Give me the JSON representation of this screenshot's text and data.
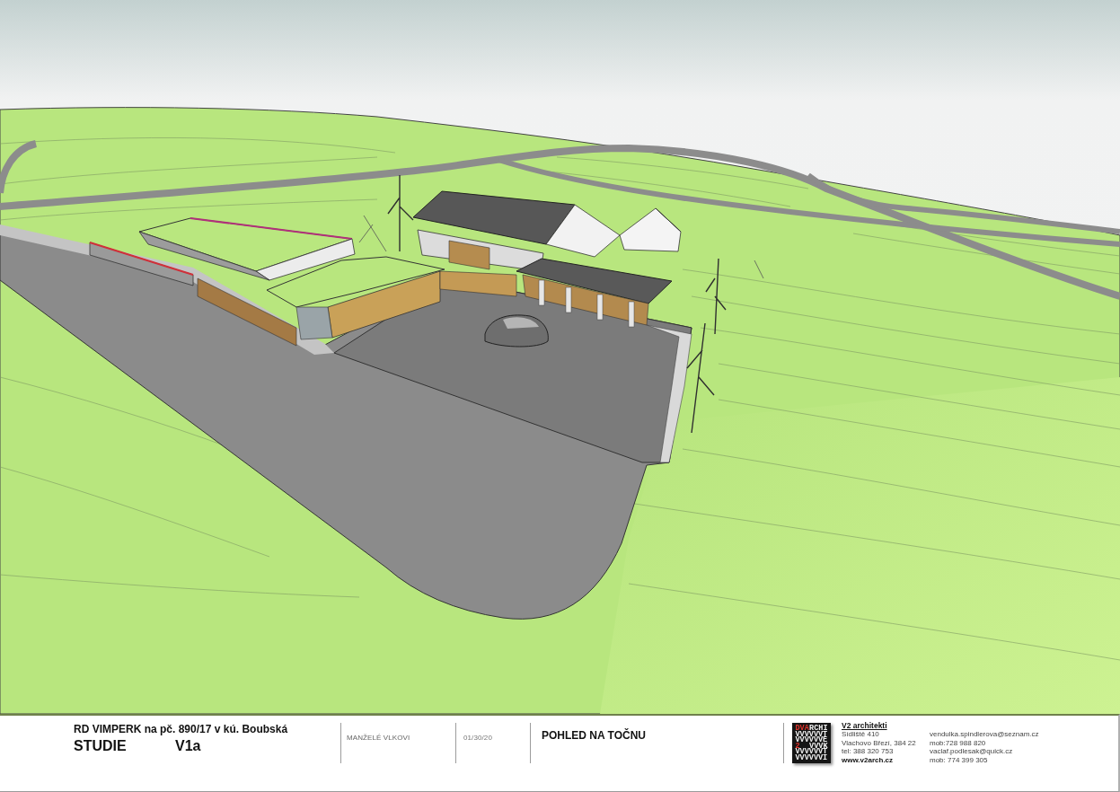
{
  "title_block": {
    "project": "RD VIMPERK na pč. 890/17 v kú. Boubská",
    "phase": "STUDIE",
    "version": "V1a",
    "client": "MANŽELÉ VLKOVI",
    "date": "01/30/20",
    "drawing_title": "POHLED NA TOČNU",
    "logo": {
      "lines": [
        [
          {
            "text": "DVA",
            "accent": true
          },
          {
            "text": "RCHI",
            "accent": false
          }
        ],
        [
          {
            "text": "VVVVVVT",
            "accent": false
          }
        ],
        [
          {
            "text": "VVVVVVE",
            "accent": false
          }
        ],
        [
          {
            "text": "2",
            "accent": true
          },
          {
            "text": "VVVK",
            "accent": false
          }
        ],
        [
          {
            "text": "VVVVVVT",
            "accent": false
          }
        ],
        [
          {
            "text": "VVVVVVI",
            "accent": false
          }
        ]
      ]
    },
    "office": {
      "name": "V2 architekti",
      "address": [
        "Sídliště 410",
        "Vlachovo Březí, 384 22",
        "tel: 388 320 753"
      ],
      "website": "www.v2arch.cz"
    },
    "contacts": [
      "vendulka.spindlerova@seznam.cz",
      "mob:728 988 820",
      "vaclaf.podlesak@quick.cz",
      "mob: 774 399 305"
    ]
  }
}
